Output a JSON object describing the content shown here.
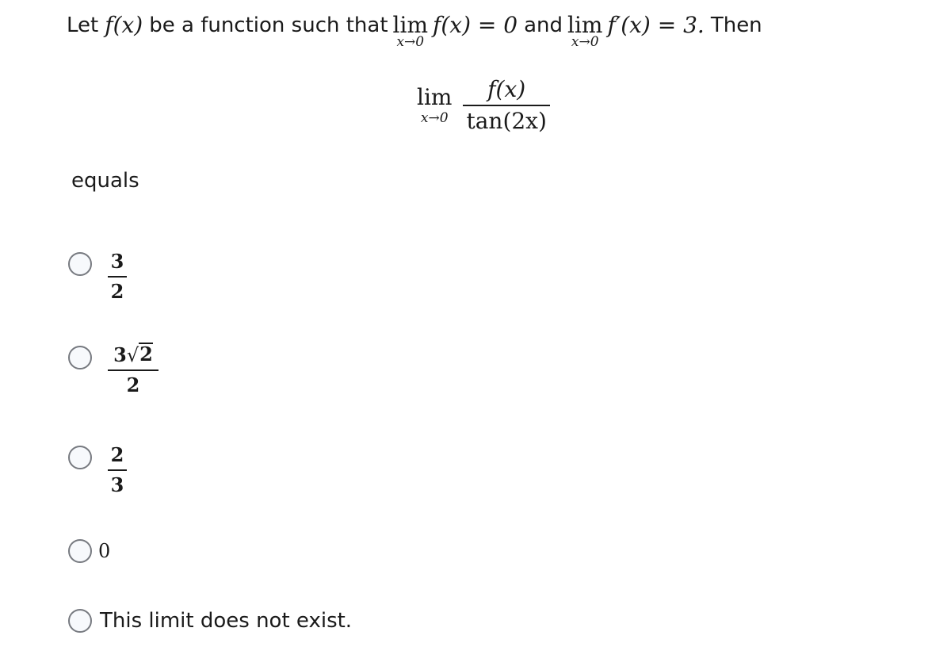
{
  "question": {
    "intro": "Let",
    "f_of_x": "f(x)",
    "middle": "be a function such that",
    "lim_word": "lim",
    "lim_sub": "x→0",
    "cond1": "f(x) = 0",
    "and": "and",
    "cond2": "f′(x) = 3.",
    "then": "Then"
  },
  "display": {
    "lim_word": "lim",
    "lim_sub": "x→0",
    "numerator": "f(x)",
    "denominator": "tan(2x)"
  },
  "equals_label": "equals",
  "options": [
    {
      "type": "fraction",
      "numerator": "3",
      "denominator": "2",
      "selected": false
    },
    {
      "type": "fraction-sqrt",
      "num_coeff": "3",
      "num_radicand": "2",
      "radical": "√",
      "denominator": "2",
      "selected": false
    },
    {
      "type": "fraction",
      "numerator": "2",
      "denominator": "3",
      "selected": false
    },
    {
      "type": "plain",
      "value": "0",
      "selected": false
    },
    {
      "type": "text",
      "value": "This limit does not exist.",
      "selected": false
    }
  ]
}
